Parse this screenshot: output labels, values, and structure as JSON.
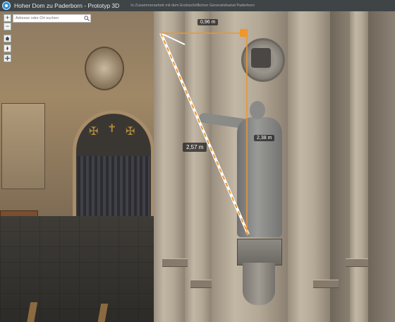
{
  "header": {
    "title": "Hoher Dom zu Paderborn - Prototyp 3D",
    "subtitle": "In Zusammenarbeit mit dem Erzbischöflichen Generalvikariat Paderborn"
  },
  "search": {
    "placeholder": "Adresse oder Ort suchen",
    "value": ""
  },
  "navigation": {
    "zoom_in_label": "+",
    "zoom_out_label": "−",
    "icons": [
      "plus-icon",
      "minus-icon",
      "home-icon",
      "compass-icon",
      "navigation-mode-icon"
    ]
  },
  "measurement": {
    "horizontal_label": "0,96 m",
    "direct_label": "2,57 m",
    "vertical_label": "2,38 m",
    "accent_color": "#f0962b",
    "line_color": "#ffffff"
  }
}
